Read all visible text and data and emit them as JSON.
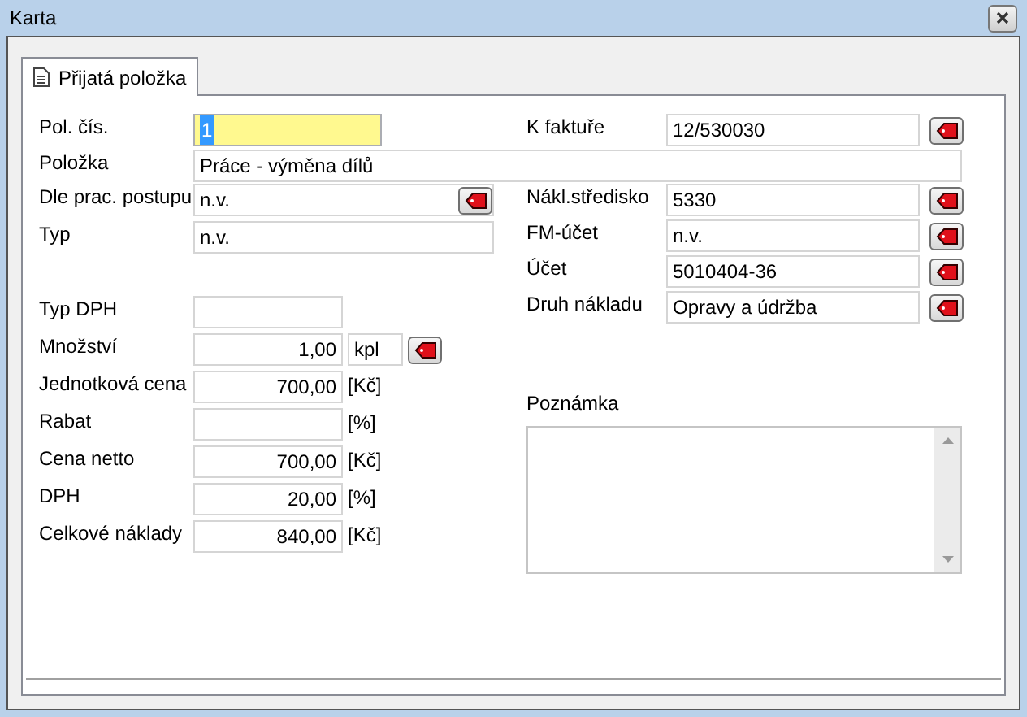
{
  "window": {
    "title": "Karta"
  },
  "tabs": [
    {
      "label": "Přijatá položka",
      "selected": true
    }
  ],
  "top_left": {
    "label": "Pol. čís.",
    "value": "1",
    "focused": true
  },
  "top_right": {
    "label": "K faktuře",
    "value": "12/530030",
    "button": true
  },
  "item": {
    "label": "Položka",
    "value": "Práce - výměna dílů"
  },
  "left_fields": [
    {
      "label": "Dle prac. postupu",
      "value": "n.v.",
      "kind": "wide",
      "button": true
    },
    {
      "label": "Typ",
      "value": "n.v.",
      "kind": "wide",
      "button": false
    },
    {
      "kind": "spacer"
    },
    {
      "label": "Typ DPH",
      "kind": "number",
      "button": false
    },
    {
      "label": "Množství",
      "value": "1,00",
      "kind": "number",
      "unit_field": "kpl",
      "button": true
    },
    {
      "label": "Jednotková cena",
      "value": "700,00",
      "kind": "number",
      "unit": "[Kč]",
      "button": false
    },
    {
      "label": "Rabat",
      "kind": "number",
      "unit": "[%]",
      "button": false
    },
    {
      "label": "Cena netto",
      "value": "700,00",
      "kind": "number",
      "unit": "[Kč]",
      "button": false
    },
    {
      "label": "DPH",
      "value": "20,00",
      "kind": "number",
      "unit": "[%]",
      "button": false
    },
    {
      "label": "Celkové náklady",
      "value": "840,00",
      "kind": "number",
      "unit": "[Kč]",
      "button": false
    }
  ],
  "right_fields": [
    {
      "label": "Nákl.středisko",
      "value": "5330",
      "button": true
    },
    {
      "label": "FM-účet",
      "value": "n.v.",
      "button": true
    },
    {
      "label": "Účet",
      "value": "5010404-36",
      "button": true
    },
    {
      "label": "Druh nákladu",
      "value": "Opravy a údržba",
      "button": true
    }
  ],
  "note": {
    "label": "Poznámka"
  }
}
